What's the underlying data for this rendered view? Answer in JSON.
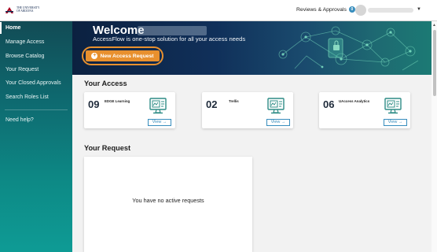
{
  "header": {
    "logo_line1": "THE UNIVERSITY",
    "logo_line2": "OF ARIZONA",
    "reviews_label": "Reviews & Approvals",
    "reviews_count": "0"
  },
  "sidebar": {
    "items": [
      {
        "label": "Home"
      },
      {
        "label": "Manage Access"
      },
      {
        "label": "Browse Catalog"
      },
      {
        "label": "Your Request"
      },
      {
        "label": "Your Closed Approvals"
      },
      {
        "label": "Search Roles List"
      }
    ],
    "help_label": "Need help?"
  },
  "hero": {
    "title": "Welcome",
    "subtitle": "AccessFlow is one-stop solution for all your access needs",
    "button_label": "New Access Request"
  },
  "your_access": {
    "title": "Your Access",
    "cards": [
      {
        "count": "09",
        "name": "EDGE Learning",
        "view_label": "View →"
      },
      {
        "count": "02",
        "name": "Trellis",
        "view_label": "View →"
      },
      {
        "count": "06",
        "name": "UAccess Analytics",
        "view_label": "View →"
      }
    ]
  },
  "your_request": {
    "title": "Your Request",
    "empty_message": "You have no active requests"
  },
  "colors": {
    "accent_orange": "#e8902e",
    "link_blue": "#378dbd",
    "banner_navy": "#0c2140",
    "sidebar_teal": "#0e6a70"
  }
}
